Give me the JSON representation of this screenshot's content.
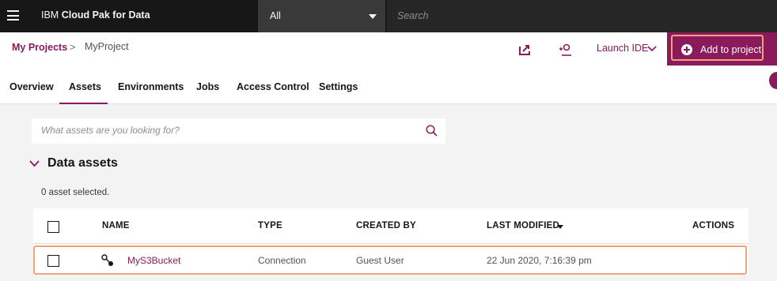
{
  "topbar": {
    "brand_prefix": "IBM",
    "brand_name": "Cloud Pak for Data",
    "scope_value": "All",
    "search_placeholder": "Search"
  },
  "header": {
    "breadcrumb_root": "My Projects",
    "breadcrumb_separator": ">",
    "breadcrumb_current": "MyProject",
    "launch_ide_label": "Launch IDE",
    "add_button_label": "Add to project"
  },
  "tabs": [
    {
      "label": "Overview",
      "active": false
    },
    {
      "label": "Assets",
      "active": true
    },
    {
      "label": "Environments",
      "active": false
    },
    {
      "label": "Jobs",
      "active": false
    },
    {
      "label": "Access Control",
      "active": false
    },
    {
      "label": "Settings",
      "active": false
    }
  ],
  "assets": {
    "search_placeholder": "What assets are you looking for?",
    "section_title": "Data assets",
    "selection_status": "0 asset selected.",
    "columns": {
      "name": "NAME",
      "type": "TYPE",
      "created_by": "CREATED BY",
      "last_modified": "LAST MODIFIED",
      "actions": "ACTIONS"
    },
    "rows": [
      {
        "name": "MyS3Bucket",
        "type": "Connection",
        "created_by": "Guest User",
        "last_modified": "22 Jun 2020, 7:16:39 pm",
        "icon": "connection-icon"
      }
    ]
  },
  "colors": {
    "accent": "#8a1a5b",
    "highlight": "#f0a37c",
    "topbar": "#171717"
  }
}
